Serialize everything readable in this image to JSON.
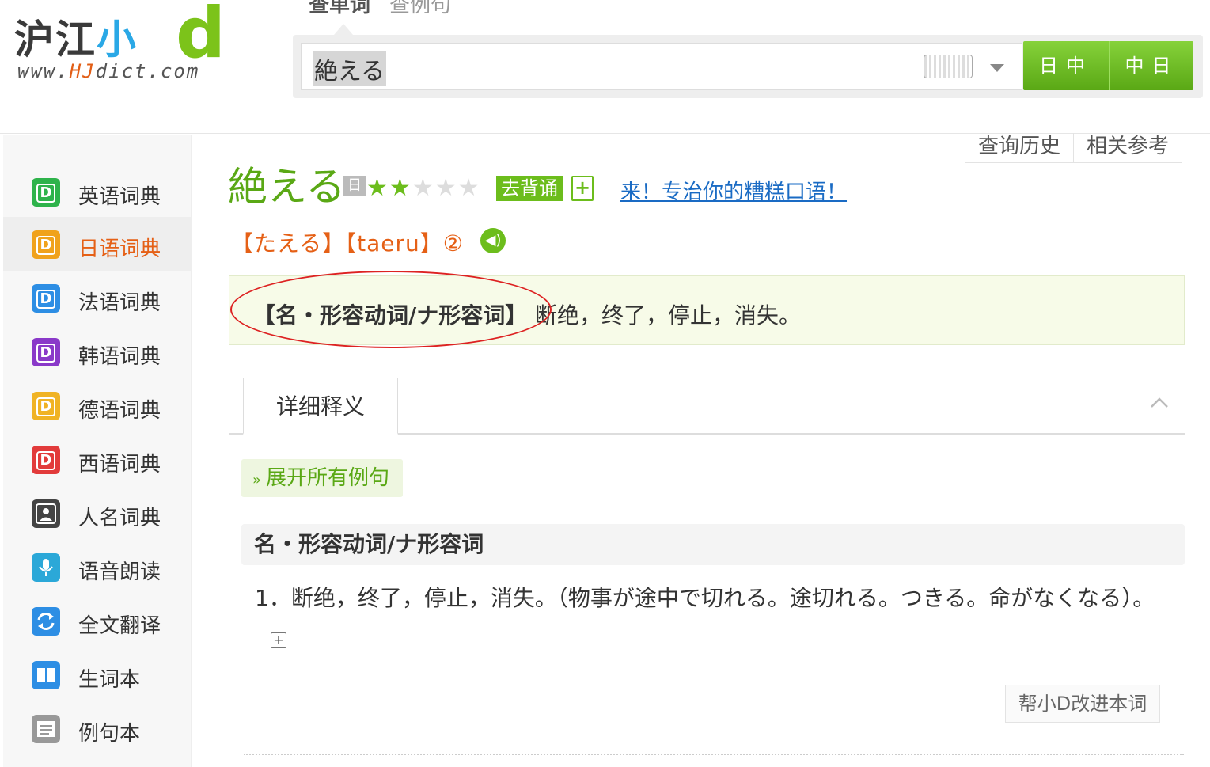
{
  "logo": {
    "text_cn": "沪江",
    "text_xiao": "小",
    "text_d": "d",
    "url_prefix": "www.",
    "url_brand": "HJ",
    "url_suffix": "dict.com"
  },
  "mode_tabs": [
    "查单词",
    "查例句"
  ],
  "search": {
    "value": "絶える",
    "btn_jc": "日中",
    "btn_cj": "中日"
  },
  "colors": {
    "brand_green": "#6cbd1c",
    "accent_orange": "#e56016",
    "link_blue": "#1a6bc4",
    "ellipse_red": "#dd2222"
  },
  "sidebar": {
    "items": [
      {
        "label": "英语词典",
        "icon": "D",
        "color": "#2eb34b"
      },
      {
        "label": "日语词典",
        "icon": "D",
        "color": "#f0a21c",
        "active": true
      },
      {
        "label": "法语词典",
        "icon": "D",
        "color": "#2d8ee4"
      },
      {
        "label": "韩语词典",
        "icon": "D",
        "color": "#8a39c9"
      },
      {
        "label": "德语词典",
        "icon": "D",
        "color": "#f0b324"
      },
      {
        "label": "西语词典",
        "icon": "D",
        "color": "#e23b3b"
      },
      {
        "label": "人名词典",
        "icon": "person-icon",
        "color": "#444444"
      },
      {
        "label": "语音朗读",
        "icon": "microphone-icon",
        "color": "#2ba8d8"
      },
      {
        "label": "全文翻译",
        "icon": "refresh-icon",
        "color": "#2d8ee4"
      },
      {
        "label": "生词本",
        "icon": "book-icon",
        "color": "#2d8ee4"
      },
      {
        "label": "例句本",
        "icon": "notes-icon",
        "color": "#999999"
      }
    ]
  },
  "top_links": [
    "查询历史",
    "相关参考"
  ],
  "entry": {
    "word": "絶える",
    "lang_tag": "日",
    "stars_filled": 2,
    "stars_total": 5,
    "recite_label": "去背诵",
    "promo_link": "来！专治你的糟糕口语！",
    "pronunciation": "【たえる】【taeru】②",
    "pos_brief": "【名・形容动词/ナ形容词】",
    "meaning_brief": "断绝，终了，停止，消失。"
  },
  "detail": {
    "tab_label": "详细释义",
    "expand_label": "展开所有例句",
    "pos": "名・形容动词/ナ形容词",
    "sense": "1．断绝，终了，停止，消失。（物事が途中で切れる。途切れる。つきる。命がなくなる）。",
    "improve_label": "帮小D改进本词"
  }
}
